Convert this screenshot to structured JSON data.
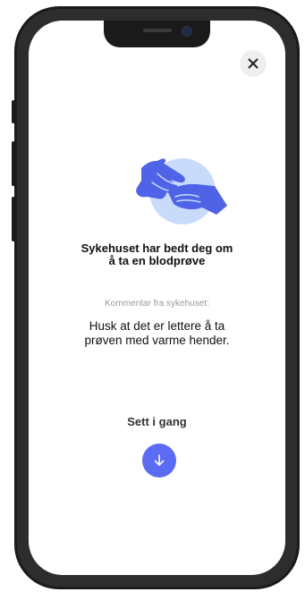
{
  "dialog": {
    "title_line1": "Sykehuset har bedt deg om",
    "title_line2": "å ta en blodprøve",
    "comment_label": "Kommentar fra sykehuset:",
    "comment_line1": "Husk at det er lettere å ta",
    "comment_line2": "prøven med varme hender.",
    "start_label": "Sett i gang"
  },
  "icons": {
    "close": "close-icon",
    "start": "arrow-down-icon",
    "illustration": "hands-illustration"
  },
  "colors": {
    "accent": "#5c6cf2",
    "illustration_primary": "#4f63e6",
    "illustration_circle": "#c9dbfb"
  }
}
